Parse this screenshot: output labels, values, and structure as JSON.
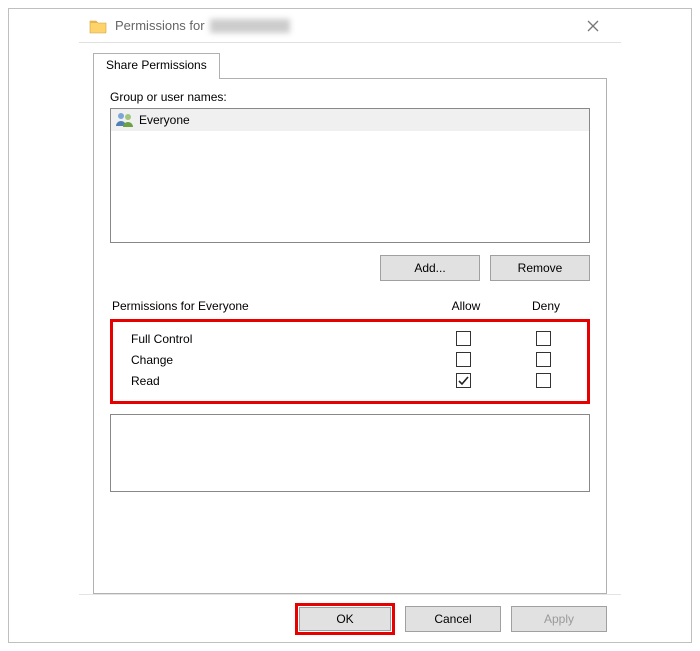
{
  "window": {
    "title_prefix": "Permissions for",
    "close_label": "Close"
  },
  "tab": {
    "share_permissions": "Share Permissions"
  },
  "labels": {
    "group_or_user": "Group or user names:",
    "permissions_for_prefix": "Permissions for Everyone",
    "allow": "Allow",
    "deny": "Deny"
  },
  "users": [
    {
      "name": "Everyone"
    }
  ],
  "buttons": {
    "add": "Add...",
    "remove": "Remove",
    "ok": "OK",
    "cancel": "Cancel",
    "apply": "Apply"
  },
  "permissions": [
    {
      "name": "Full Control",
      "allow": false,
      "deny": false
    },
    {
      "name": "Change",
      "allow": false,
      "deny": false
    },
    {
      "name": "Read",
      "allow": true,
      "deny": false
    }
  ],
  "colors": {
    "highlight": "#e60000"
  }
}
